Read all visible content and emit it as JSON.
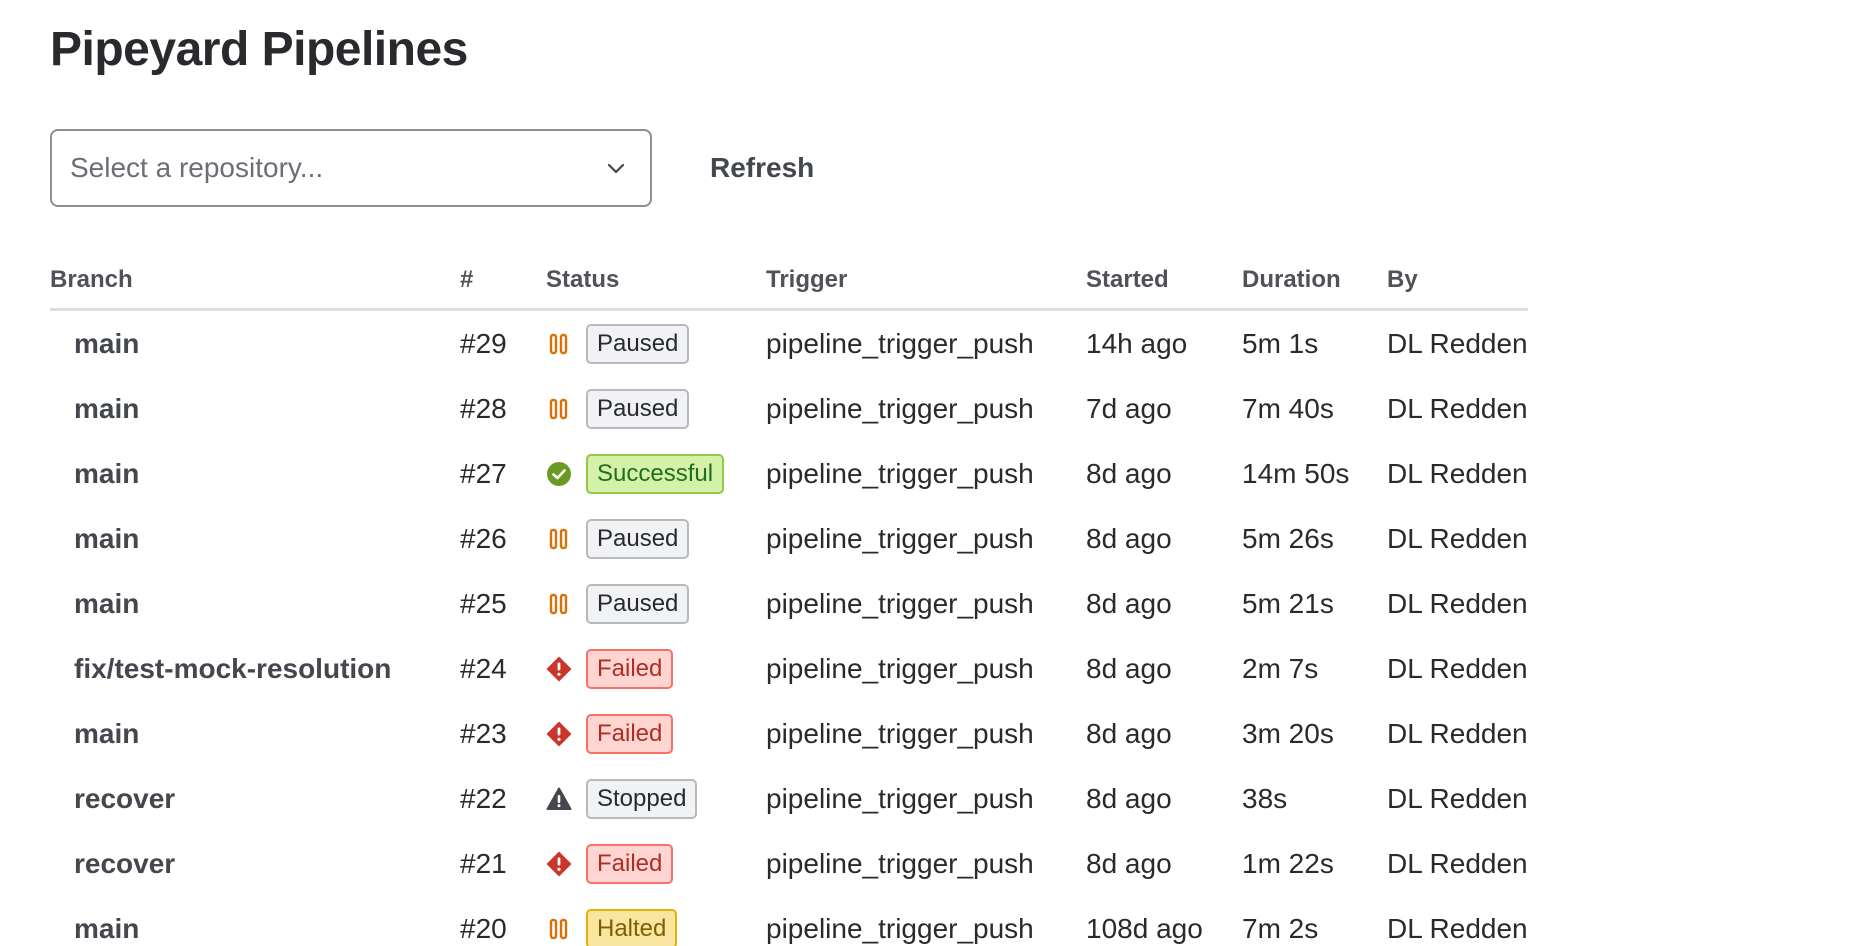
{
  "page": {
    "title": "Pipeyard Pipelines"
  },
  "controls": {
    "repo_select_placeholder": "Select a repository...",
    "refresh_label": "Refresh"
  },
  "table": {
    "headers": {
      "branch": "Branch",
      "number": "#",
      "status": "Status",
      "trigger": "Trigger",
      "started": "Started",
      "duration": "Duration",
      "by": "By"
    },
    "rows": [
      {
        "branch": "main",
        "number": "#29",
        "status": "Paused",
        "status_icon": "pause-icon",
        "trigger": "pipeline_trigger_push",
        "started": "14h ago",
        "duration": "5m 1s",
        "by": "DL Redden"
      },
      {
        "branch": "main",
        "number": "#28",
        "status": "Paused",
        "status_icon": "pause-icon",
        "trigger": "pipeline_trigger_push",
        "started": "7d ago",
        "duration": "7m 40s",
        "by": "DL Redden"
      },
      {
        "branch": "main",
        "number": "#27",
        "status": "Successful",
        "status_icon": "check-circle-icon",
        "trigger": "pipeline_trigger_push",
        "started": "8d ago",
        "duration": "14m 50s",
        "by": "DL Redden"
      },
      {
        "branch": "main",
        "number": "#26",
        "status": "Paused",
        "status_icon": "pause-icon",
        "trigger": "pipeline_trigger_push",
        "started": "8d ago",
        "duration": "5m 26s",
        "by": "DL Redden"
      },
      {
        "branch": "main",
        "number": "#25",
        "status": "Paused",
        "status_icon": "pause-icon",
        "trigger": "pipeline_trigger_push",
        "started": "8d ago",
        "duration": "5m 21s",
        "by": "DL Redden"
      },
      {
        "branch": "fix/test-mock-resolution",
        "number": "#24",
        "status": "Failed",
        "status_icon": "error-diamond-icon",
        "trigger": "pipeline_trigger_push",
        "started": "8d ago",
        "duration": "2m 7s",
        "by": "DL Redden"
      },
      {
        "branch": "main",
        "number": "#23",
        "status": "Failed",
        "status_icon": "error-diamond-icon",
        "trigger": "pipeline_trigger_push",
        "started": "8d ago",
        "duration": "3m 20s",
        "by": "DL Redden"
      },
      {
        "branch": "recover",
        "number": "#22",
        "status": "Stopped",
        "status_icon": "warning-triangle-icon",
        "trigger": "pipeline_trigger_push",
        "started": "8d ago",
        "duration": "38s",
        "by": "DL Redden"
      },
      {
        "branch": "recover",
        "number": "#21",
        "status": "Failed",
        "status_icon": "error-diamond-icon",
        "trigger": "pipeline_trigger_push",
        "started": "8d ago",
        "duration": "1m 22s",
        "by": "DL Redden"
      },
      {
        "branch": "main",
        "number": "#20",
        "status": "Halted",
        "status_icon": "pause-icon",
        "trigger": "pipeline_trigger_push",
        "started": "108d ago",
        "duration": "7m 2s",
        "by": "DL Redden"
      }
    ]
  },
  "colors": {
    "paused_icon": "#d97008",
    "success_icon": "#6a9a23",
    "failed_icon": "#c9372c",
    "stopped_icon": "#44474e",
    "halted_icon": "#d97008"
  }
}
